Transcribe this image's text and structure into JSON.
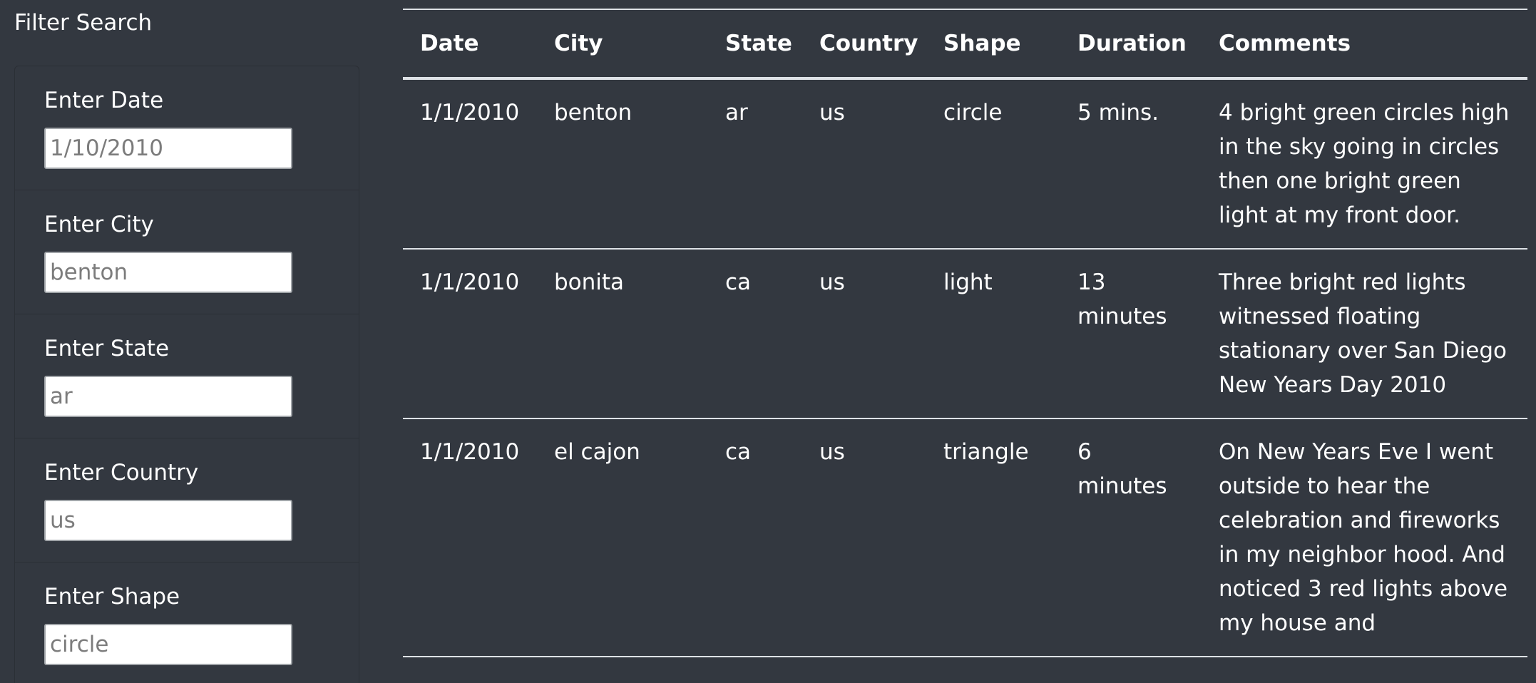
{
  "sidebar": {
    "title": "Filter Search",
    "filters": [
      {
        "label": "Enter Date",
        "placeholder": "1/10/2010"
      },
      {
        "label": "Enter City",
        "placeholder": "benton"
      },
      {
        "label": "Enter State",
        "placeholder": "ar"
      },
      {
        "label": "Enter Country",
        "placeholder": "us"
      },
      {
        "label": "Enter Shape",
        "placeholder": "circle"
      }
    ]
  },
  "table": {
    "headers": [
      "Date",
      "City",
      "State",
      "Country",
      "Shape",
      "Duration",
      "Comments"
    ],
    "rows": [
      [
        "1/1/2010",
        "benton",
        "ar",
        "us",
        "circle",
        "5 mins.",
        "4 bright green circles high in the sky going in circles then one bright green light at my front door."
      ],
      [
        "1/1/2010",
        "bonita",
        "ca",
        "us",
        "light",
        "13 minutes",
        "Three bright red lights witnessed floating stationary over San Diego New Years Day 2010"
      ],
      [
        "1/1/2010",
        "el cajon",
        "ca",
        "us",
        "triangle",
        "6 minutes",
        "On New Years Eve I went outside to hear the celebration and fireworks in my neighbor hood. And noticed 3 red lights above my house and"
      ]
    ]
  },
  "colors": {
    "background": "#333840",
    "table_border": "#dee2e6",
    "panel_border": "#2b2f35"
  }
}
